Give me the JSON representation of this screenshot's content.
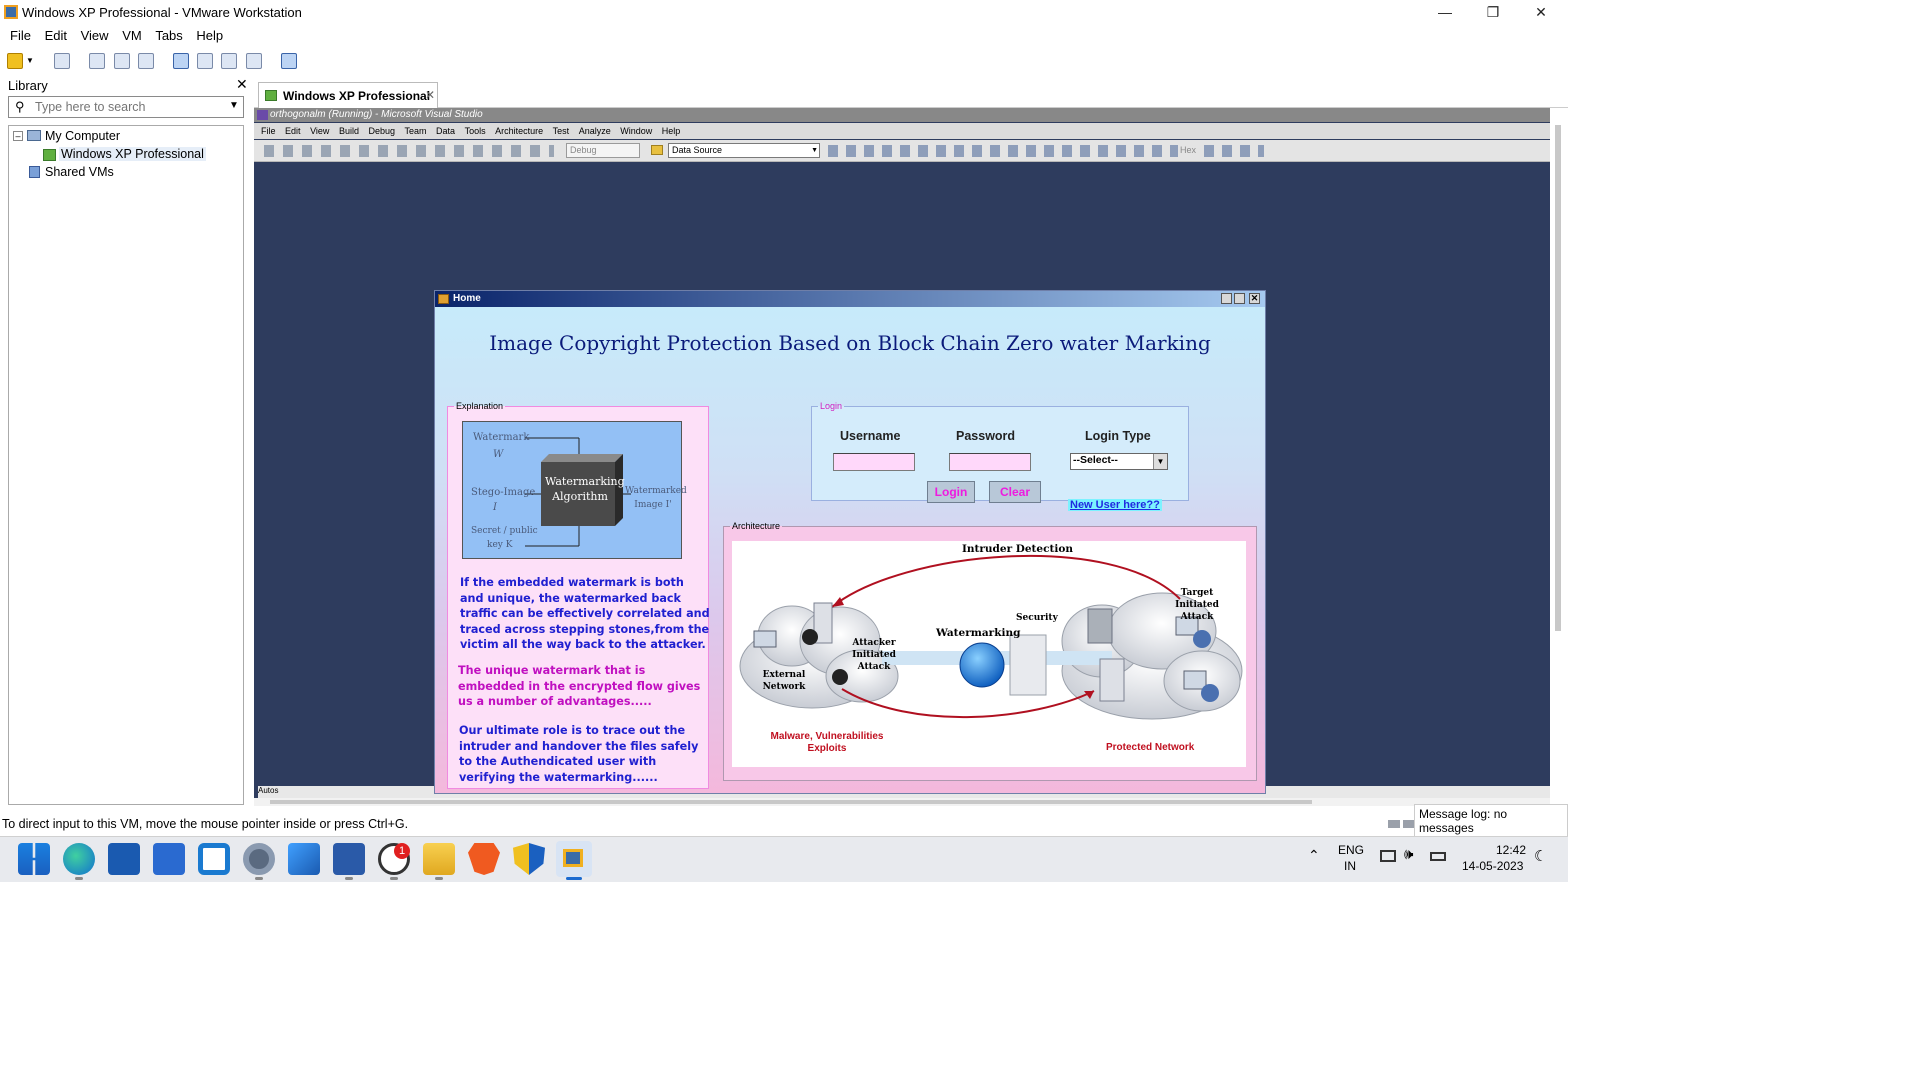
{
  "window": {
    "title": "Windows XP Professional - VMware Workstation"
  },
  "menu": [
    "File",
    "Edit",
    "View",
    "VM",
    "Tabs",
    "Help"
  ],
  "library": {
    "title": "Library",
    "search_placeholder": "Type here to search",
    "tree": [
      "My Computer",
      "Windows XP Professional",
      "Shared VMs"
    ]
  },
  "tab": {
    "label": "Windows XP Professional"
  },
  "vs": {
    "title": "orthogonalm (Running) - Microsoft Visual Studio",
    "menu": [
      "File",
      "Edit",
      "View",
      "Build",
      "Debug",
      "Team",
      "Data",
      "Tools",
      "Architecture",
      "Test",
      "Analyze",
      "Window",
      "Help"
    ],
    "config": "Debug",
    "data_source": "Data Source",
    "hex": "Hex",
    "autos": "Autos"
  },
  "form": {
    "title": "Home",
    "heading": "Image Copyright  Protection Based on Block Chain  Zero water Marking",
    "explanation": {
      "legend": "Explanation",
      "diagram": {
        "watermark": "Watermark",
        "w": "W",
        "stego": "Stego-Image",
        "i": "I",
        "secret": "Secret / public",
        "key": "key K",
        "algo": "Watermarking Algorithm",
        "out": "Watermarked Image I'"
      },
      "p1": "If the embedded watermark is both and unique, the watermarked back traffic can be effectively correlated and traced across stepping stones,from the victim all the way back to the attacker.",
      "p2": "The unique watermark that is embedded in the encrypted flow gives us a number of advantages.....",
      "p3": "Our ultimate role is to trace out the intruder and  handover the files safely to the Authendicated user with verifying the watermarking......"
    },
    "login": {
      "legend": "Login",
      "username_label": "Username",
      "password_label": "Password",
      "type_label": "Login Type",
      "select_value": "--Select--",
      "login_btn": "Login",
      "clear_btn": "Clear",
      "new_user": "New User here??"
    },
    "architecture": {
      "legend": "Architecture",
      "intruder": "Intruder Detection",
      "target": "Target Initiated Attack",
      "attacker": "Attacker Initiated Attack",
      "watermarking": "Watermarking",
      "security": "Security",
      "external": "External Network",
      "malware": "Malware, Vulnerabilities Exploits",
      "protected": "Protected Network"
    }
  },
  "status": {
    "message": "To direct input to this VM, move the mouse pointer inside or press Ctrl+G.",
    "log": "Message log: no messages"
  },
  "taskbar": {
    "lang1": "ENG",
    "lang2": "IN",
    "time": "12:42",
    "date": "14-05-2023",
    "whatsapp_badge": "1"
  },
  "colors": {
    "accent": "#0a246a",
    "form_heading": "#0a1a7a",
    "button_text": "#ee1ae0",
    "vm_bg": "#2e3c5e"
  }
}
